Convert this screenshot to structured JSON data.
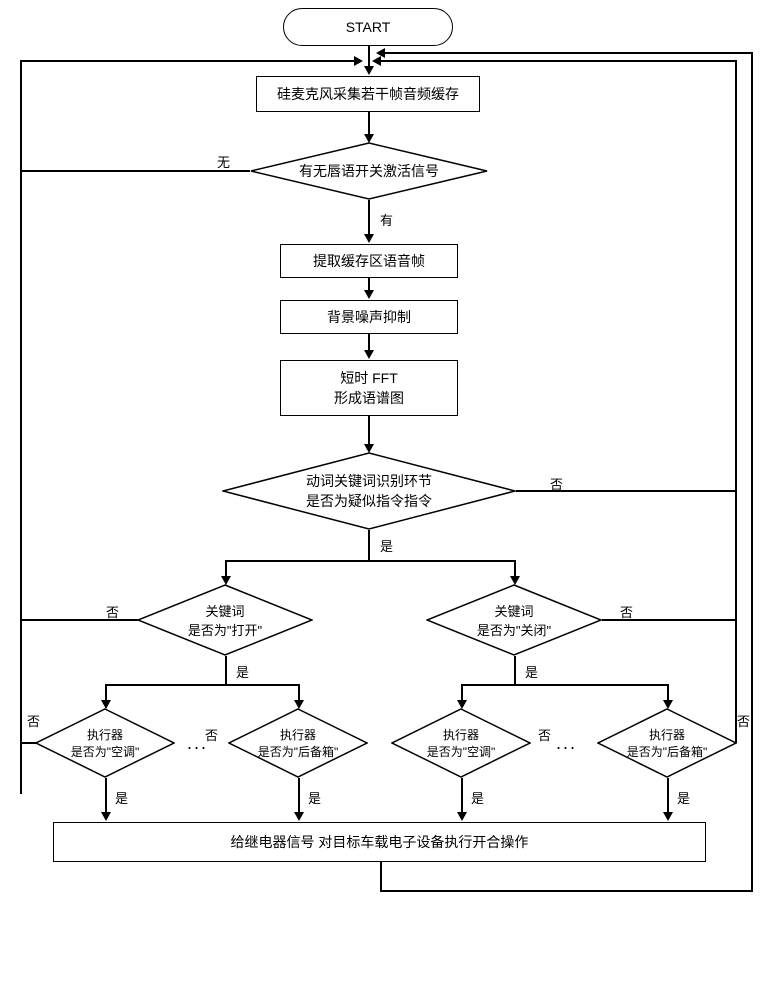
{
  "nodes": {
    "start": "START",
    "collect": "硅麦克风采集若干帧音频缓存",
    "lip_signal": "有无唇语开关激活信号",
    "lip_yes": "有",
    "lip_no": "无",
    "extract": "提取缓存区语音帧",
    "suppress": "背景噪声抑制",
    "fft_l1": "短时 FFT",
    "fft_l2": "形成语谱图",
    "verb_l1": "动词关键词识别环节",
    "verb_l2": "是否为疑似指令指令",
    "kw_open_l1": "关键词",
    "kw_open_l2": "是否为\"打开\"",
    "kw_close_l1": "关键词",
    "kw_close_l2": "是否为\"关闭\"",
    "exec_ac_l1": "执行器",
    "exec_ac_l2": "是否为\"空调\"",
    "exec_trunk_l1": "执行器",
    "exec_trunk_l2": "是否为\"后备箱\"",
    "relay": "给继电器信号   对目标车载电子设备执行开合操作",
    "yes": "是",
    "no": "否",
    "dots": "..."
  }
}
